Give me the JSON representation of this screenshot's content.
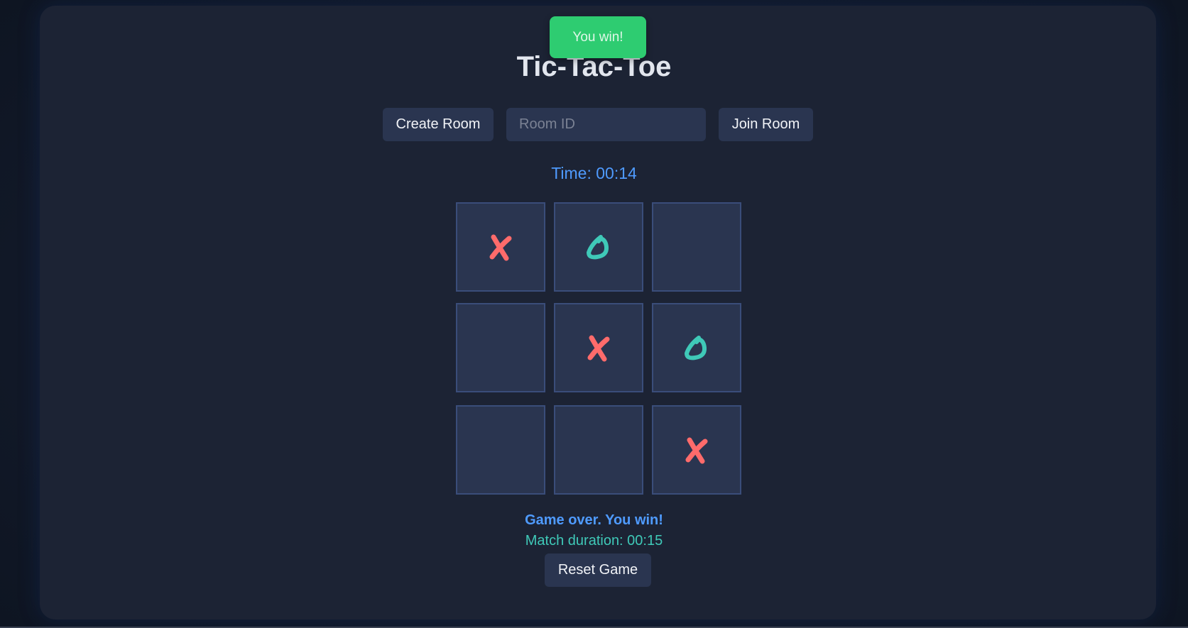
{
  "toast": {
    "text": "You win!",
    "color": "#2ecc71"
  },
  "title": "Tic-Tac-Toe",
  "controls": {
    "create_label": "Create Room",
    "room_placeholder": "Room ID",
    "room_value": "",
    "join_label": "Join Room"
  },
  "timer": "Time: 00:14",
  "board": {
    "cells": [
      "X",
      "O",
      "",
      "",
      "X",
      "O",
      "",
      "",
      "X"
    ],
    "x_color": "#ff6b6b",
    "o_color": "#3fc9b8"
  },
  "status": "Game over. You win!",
  "duration": "Match duration: 00:15",
  "reset_label": "Reset Game"
}
